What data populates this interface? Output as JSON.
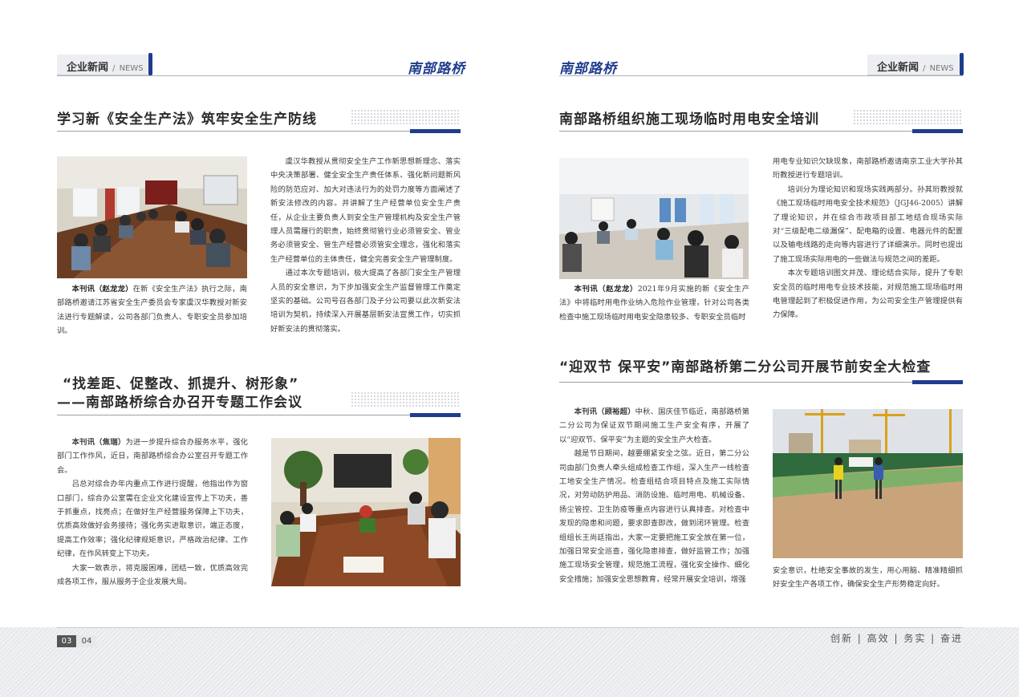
{
  "left_page": {
    "section_tab": {
      "cn": "企业新闻",
      "sep": "/",
      "en": "NEWS"
    },
    "brand": "南部路桥",
    "article1": {
      "title": "学习新《安全生产法》筑牢安全生产防线",
      "caption_lead": "本刊讯（赵龙龙）",
      "caption": "在新《安全生产法》执行之际，南部路桥邀请江苏省安全生产委员会专家虞汉华教授对新安法进行专题解读，公司各部门负责人、专职安全员参加培训。",
      "para1": "虞汉华教授从贯彻安全生产工作新思想新理念、落实中央决策部署、健全安全生产责任体系、强化新问题新风险的防范应对、加大对违法行为的处罚力度等方面阐述了新安法修改的内容。并讲解了生产经营单位安全生产责任，从企业主要负责人到安全生产管理机构及安全生产管理人员需履行的职责，始终贯彻管行业必须管安全、管业务必须管安全、管生产经营必须管安全理念，强化和落实生产经营单位的主体责任，健全完善安全生产管理制度。",
      "para2": "通过本次专题培训，极大提高了各部门安全生产管理人员的安全意识，为下步加强安全生产监督管理工作奠定坚实的基础。公司号召各部门及子分公司要以此次新安法培训为契机，持续深入开展基层新安法宣贯工作，切实抓好新安法的贯彻落实。"
    },
    "article2": {
      "title_line1": "“找差距、促整改、抓提升、树形象”",
      "title_line2": "——南部路桥综合办召开专题工作会议",
      "para1_lead": "本刊讯（焦瑞）",
      "para1": "为进一步提升综合办服务水平，强化部门工作作风，近日，南部路桥综合办公室召开专题工作会。",
      "para2": "吕总对综合办年内重点工作进行提醒，他指出作为窗口部门，综合办公室需在企业文化建设宣传上下功夫，善于抓重点，找亮点；在做好生产经营服务保障上下功夫，优质高效做好会务接待；强化务实进取意识，端正态度，提高工作效率；强化纪律规矩意识，严格政治纪律、工作纪律，在作风转变上下功夫。",
      "para3": "大家一致表示，将克服困难，团结一致，优质高效完成各项工作，服从服务于企业发展大局。"
    },
    "page_numbers": [
      "03",
      "04"
    ]
  },
  "right_page": {
    "section_tab": {
      "cn": "企业新闻",
      "sep": "/",
      "en": "NEWS"
    },
    "brand": "南部路桥",
    "article3": {
      "title": "南部路桥组织施工现场临时用电安全培训",
      "caption_lead": "本刊讯（赵龙龙）",
      "caption": "2021年9月实施的新《安全生产法》中将临时用电作业纳入危险作业管理，针对公司各类检查中施工现场临时用电安全隐患较多、专职安全员临时",
      "para1": "用电专业知识欠缺现象，南部路桥邀请南京工业大学孙其珩教授进行专题培训。",
      "para2": "培训分为理论知识和现场实践两部分。孙其珩教授就《施工现场临时用电安全技术规范》（JGJ46-2005）讲解了理论知识，并在综合市政项目部工地结合现场实际对“三级配电二级漏保”、配电箱的设置、电器元件的配置以及输电线路的走向等内容进行了详细演示。同时也提出了施工现场实际用电的一些做法与规范之间的差距。",
      "para3": "本次专题培训图文并茂、理论结合实际，提升了专职安全员的临时用电专业技术技能，对规范施工现场临时用电管理起到了积极促进作用，为公司安全生产管理提供有力保障。"
    },
    "article4": {
      "title": "“迎双节 保平安”南部路桥第二分公司开展节前安全大检查",
      "para1_lead": "本刊讯（顾裕超）",
      "para1": "中秋、国庆佳节临近，南部路桥第二分公司为保证双节期间施工生产安全有序，开展了以“迎双节、保平安”为主题的安全生产大检查。",
      "para2": "越是节日期间，越要绷紧安全之弦。近日，第二分公司由部门负责人牵头组成检查工作组，深入生产一线检查工地安全生产情况。检查组结合项目特点及施工实际情况，对劳动防护用品、消防设施、临时用电、机械设备、扬尘管控、卫生防疫等重点内容进行认真排查。对检查中发现的隐患和问题，要求即查即改，做到闭环管理。检查组组长王尚廷指出，大家一定要把施工安全放在第一位，加强日常安全巡查，强化隐患排查，做好监管工作；加强施工现场安全管理，规范施工流程，强化安全操作、细化安全措施；加强安全思想教育，经常开展安全培训，增强",
      "para3": "安全意识，杜绝安全事故的发生，用心用脑、精准精细抓好安全生产各项工作，确保安全生产形势稳定向好。"
    },
    "slogan": "创新 | 高效 | 务实 | 奋进"
  },
  "colors": {
    "accent": "#1f3c8f",
    "tab_bg": "#eceef2",
    "rule": "#9aa0a8"
  }
}
